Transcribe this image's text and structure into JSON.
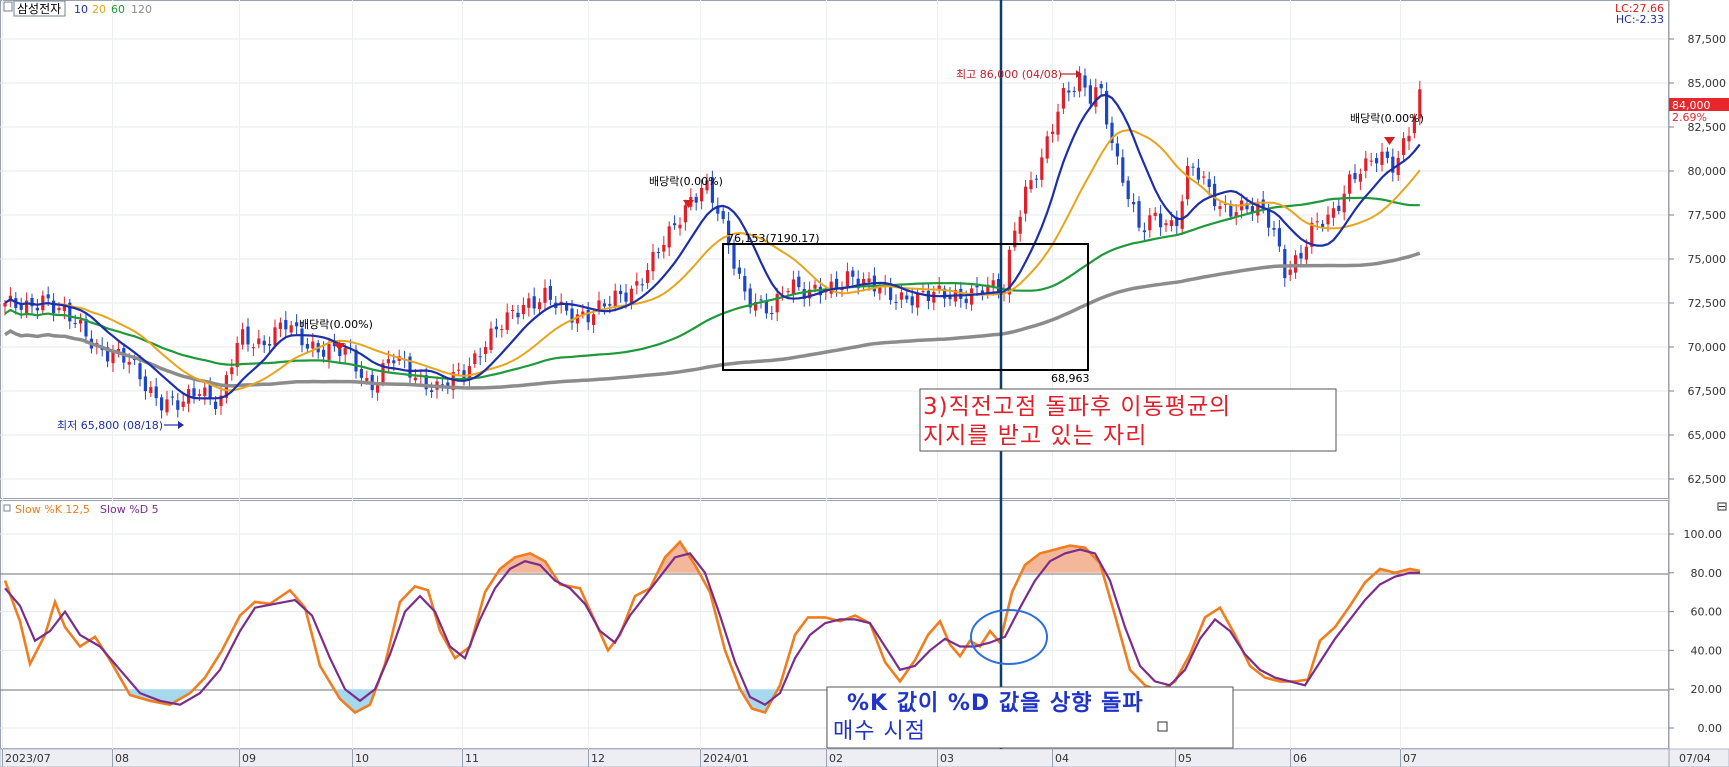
{
  "header": {
    "stock_name": "삼성전자",
    "ma_labels": [
      {
        "label": "10",
        "color": "#1c2fa8"
      },
      {
        "label": "20",
        "color": "#e8a51c"
      },
      {
        "label": "60",
        "color": "#1f9a3a"
      },
      {
        "label": "120",
        "color": "#8c8c8c"
      }
    ],
    "lc_text": "LC:27.66",
    "hc_text": "HC:-2.33"
  },
  "price_axis": {
    "ticks": [
      "87,500",
      "85,000",
      "82,500",
      "80,000",
      "77,500",
      "75,000",
      "72,500",
      "70,000",
      "67,500",
      "65,000",
      "62,500"
    ],
    "current_price": "84,000",
    "current_change": "2.69%"
  },
  "stoch_panel": {
    "legend_k": "Slow %K 12,5",
    "legend_d": "Slow %D 5",
    "ticks": [
      "100.00",
      "80.00",
      "60.00",
      "40.00",
      "20.00",
      "0.00"
    ]
  },
  "x_axis": {
    "labels": [
      "2023/07",
      "08",
      "09",
      "10",
      "11",
      "12",
      "2024/01",
      "02",
      "03",
      "04",
      "05",
      "06",
      "07",
      "07/04"
    ]
  },
  "annotations": {
    "low_label": "최저 65,800 (08/18)",
    "high_label": "최고 86,000 (04/08)",
    "dividend_1": "배당락(0.00%)",
    "dividend_2": "배당락(0.00%)",
    "dividend_3": "배당락(0.00%)",
    "box_top_label": "76,153(7190.17)",
    "box_bottom_label": "68,963",
    "callout_red_line1": "3)직전고점 돌파후 이동평균의",
    "callout_red_line2": "지지를 받고 있는 자리",
    "callout_blue_line1": "%K 값이 %D 값을 상향 돌파",
    "callout_blue_line2": "매수 시점"
  },
  "chart_data": [
    {
      "type": "candlestick",
      "title": "삼성전자",
      "ylim": [
        62000,
        88500
      ],
      "x_labels": [
        "2023/07",
        "08",
        "09",
        "10",
        "11",
        "12",
        "2024/01",
        "02",
        "03",
        "04",
        "05",
        "06",
        "07"
      ],
      "close_approx": [
        {
          "date": "2023-07-03",
          "value": 72500
        },
        {
          "date": "2023-07-20",
          "value": 70500
        },
        {
          "date": "2023-08-18",
          "value": 66500
        },
        {
          "date": "2023-09-01",
          "value": 70500
        },
        {
          "date": "2023-09-20",
          "value": 69500
        },
        {
          "date": "2023-10-12",
          "value": 68000
        },
        {
          "date": "2023-11-01",
          "value": 68000
        },
        {
          "date": "2023-12-01",
          "value": 72800
        },
        {
          "date": "2023-12-28",
          "value": 78500
        },
        {
          "date": "2024-01-17",
          "value": 72500
        },
        {
          "date": "2024-02-15",
          "value": 73500
        },
        {
          "date": "2024-03-14",
          "value": 73500
        },
        {
          "date": "2024-04-08",
          "value": 85000
        },
        {
          "date": "2024-05-02",
          "value": 76500
        },
        {
          "date": "2024-05-28",
          "value": 78000
        },
        {
          "date": "2024-06-12",
          "value": 74500
        },
        {
          "date": "2024-07-04",
          "value": 84000
        }
      ],
      "moving_averages": [
        {
          "name": "10",
          "color": "#1c2fa8"
        },
        {
          "name": "20",
          "color": "#e8a51c"
        },
        {
          "name": "60",
          "color": "#1f9a3a"
        },
        {
          "name": "120",
          "color": "#8c8c8c"
        }
      ],
      "high": {
        "value": 86000,
        "date": "04/08"
      },
      "low": {
        "value": 65800,
        "date": "08/18"
      }
    },
    {
      "type": "line",
      "title": "Slow %K 12,5 / Slow %D 5",
      "ylim": [
        -5,
        118
      ],
      "reference_lines": [
        20,
        80
      ],
      "series": [
        {
          "name": "Slow %K 12,5",
          "color": "#f07d1e"
        },
        {
          "name": "Slow %D 5",
          "color": "#7b2c8c"
        }
      ]
    }
  ]
}
